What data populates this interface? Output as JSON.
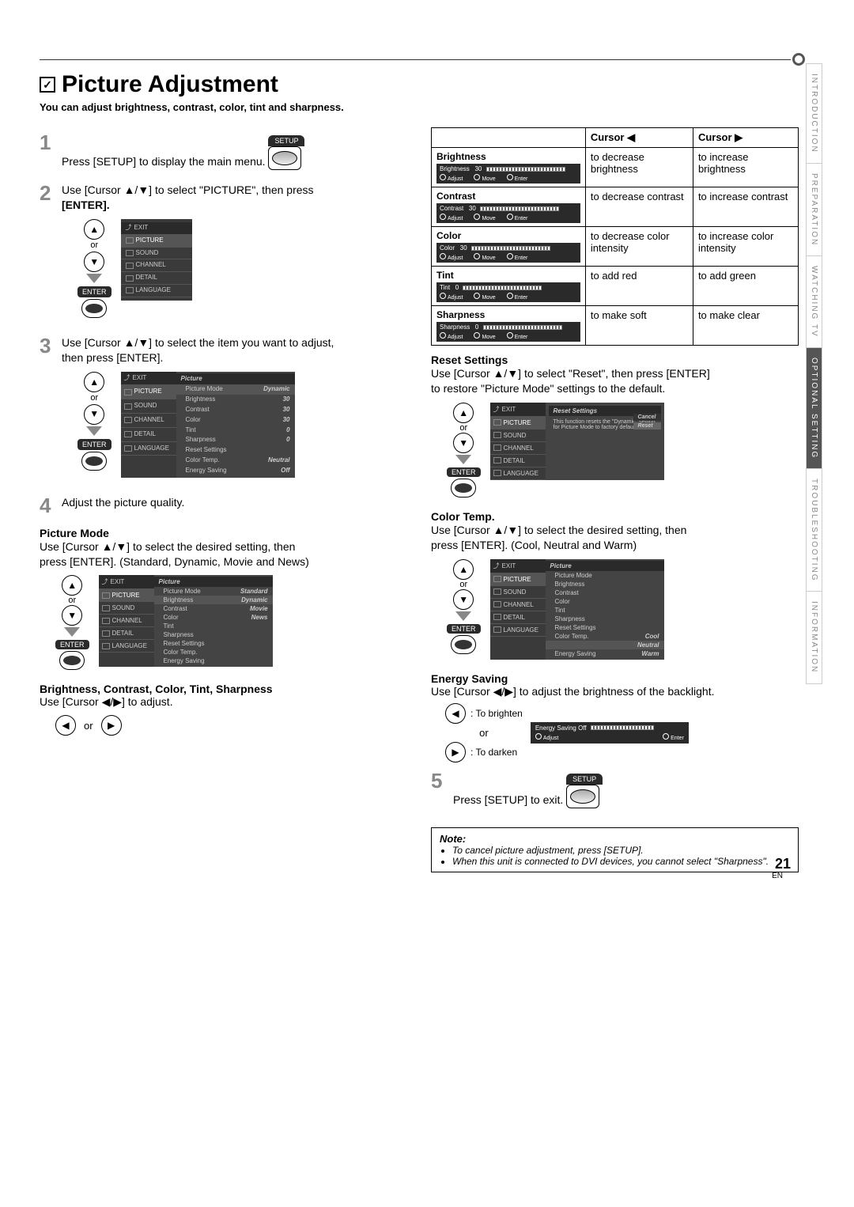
{
  "page": {
    "title": "Picture Adjustment",
    "intro": "You can adjust brightness, contrast, color, tint and sharpness.",
    "page_number": "21",
    "footer": "EN"
  },
  "side_tabs": [
    "INTRODUCTION",
    "PREPARATION",
    "WATCHING TV",
    "OPTIONAL SETTING",
    "TROUBLESHOOTING",
    "INFORMATION"
  ],
  "steps": {
    "s1": "Press [SETUP] to display the main menu.",
    "s2_a": "Use [Cursor ▲/▼] to select \"PICTURE\", then press",
    "s2_b": "[ENTER].",
    "s3_a": "Use [Cursor ▲/▼] to select the item you want to adjust,",
    "s3_b": "then press [ENTER].",
    "s4": "Adjust the picture quality.",
    "s5": "Press [SETUP] to exit."
  },
  "labels": {
    "or": "or",
    "setup": "SETUP",
    "enter": "ENTER",
    "adjust": "Adjust",
    "move": "Move",
    "enter_hint": "Enter"
  },
  "menu_items": {
    "exit": "EXIT",
    "picture": "PICTURE",
    "sound": "SOUND",
    "channel": "CHANNEL",
    "detail": "DETAIL",
    "language": "LANGUAGE"
  },
  "picture_mode": {
    "heading": "Picture Mode",
    "desc_a": "Use [Cursor ▲/▼] to select the desired setting, then",
    "desc_b": "press [ENTER]. (Standard, Dynamic, Movie and News)",
    "panel_title": "Picture",
    "items": {
      "picture_mode": "Picture Mode",
      "brightness": "Brightness",
      "contrast": "Contrast",
      "color": "Color",
      "tint": "Tint",
      "sharpness": "Sharpness",
      "reset_settings": "Reset Settings",
      "color_temp": "Color Temp.",
      "energy_saving": "Energy Saving"
    },
    "values_step3": {
      "picture_mode": "Dynamic",
      "brightness": "30",
      "contrast": "30",
      "color": "30",
      "tint": "0",
      "sharpness": "0",
      "color_temp": "Neutral",
      "energy_saving": "Off"
    },
    "values_mode": {
      "picture_mode": "Standard",
      "brightness": "Dynamic",
      "contrast": "Movie",
      "color": "News"
    }
  },
  "bcct": {
    "heading": "Brightness, Contrast, Color, Tint, Sharpness",
    "desc": "Use [Cursor ◀/▶] to adjust."
  },
  "adj_table": {
    "head_left": "Cursor ◀",
    "head_right": "Cursor ▶",
    "rows": [
      {
        "name": "Brightness",
        "slider": "Brightness",
        "val": "30",
        "left": "to decrease brightness",
        "right": "to increase brightness"
      },
      {
        "name": "Contrast",
        "slider": "Contrast",
        "val": "30",
        "left": "to decrease contrast",
        "right": "to increase contrast"
      },
      {
        "name": "Color",
        "slider": "Color",
        "val": "30",
        "left": "to decrease color intensity",
        "right": "to increase color intensity"
      },
      {
        "name": "Tint",
        "slider": "Tint",
        "val": "0",
        "left": "to add red",
        "right": "to add green"
      },
      {
        "name": "Sharpness",
        "slider": "Sharpness",
        "val": "0",
        "left": "to make soft",
        "right": "to make clear"
      }
    ]
  },
  "reset": {
    "heading": "Reset Settings",
    "desc_a": "Use [Cursor ▲/▼] to select \"Reset\", then press [ENTER]",
    "desc_b": "to restore \"Picture Mode\" settings to the default.",
    "panel_title": "Reset Settings",
    "msg": "This function resets the \"Dynamic\" setting for Picture Mode to factory default.",
    "cancel": "Cancel",
    "reset_btn": "Reset"
  },
  "color_temp": {
    "heading": "Color Temp.",
    "desc_a": "Use [Cursor ▲/▼] to select the desired setting, then",
    "desc_b": "press [ENTER]. (Cool, Neutral and Warm)",
    "values": {
      "cool": "Cool",
      "neutral": "Neutral",
      "warm": "Warm"
    }
  },
  "energy": {
    "heading": "Energy Saving",
    "desc": "Use [Cursor ◀/▶] to adjust the brightness of the backlight.",
    "brighten": ": To brighten",
    "darken": ": To darken",
    "panel_label": "Energy Saving  Off"
  },
  "note": {
    "heading": "Note:",
    "items": [
      "To cancel picture adjustment, press [SETUP].",
      "When this unit is connected to DVI devices, you cannot select \"Sharpness\"."
    ]
  }
}
